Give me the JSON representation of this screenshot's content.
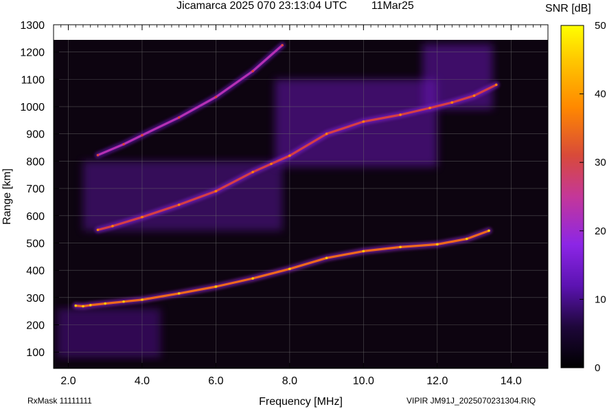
{
  "header": {
    "title": "Jicamarca 2025 070 23:13:04 UTC        11Mar25",
    "colorbar_label": "SNR [dB]"
  },
  "footer": {
    "rxmask": "RxMask 11111111",
    "filename": "VIPIR  JM91J_2025070231304.RIQ"
  },
  "chart_data": {
    "type": "heatmap",
    "title": "Jicamarca 2025 070 23:13:04 UTC        11Mar25",
    "xlabel": "Frequency [MHz]",
    "ylabel": "Range [km]",
    "xlim": [
      1.6,
      15.0
    ],
    "ylim": [
      40,
      1300
    ],
    "x_ticks": [
      2.0,
      4.0,
      6.0,
      8.0,
      10.0,
      12.0,
      14.0
    ],
    "x_tick_labels": [
      "2.0",
      "4.0",
      "6.0",
      "8.0",
      "10.0",
      "12.0",
      "14.0"
    ],
    "y_ticks": [
      100,
      200,
      300,
      400,
      500,
      600,
      700,
      800,
      900,
      1000,
      1100,
      1200,
      1300
    ],
    "y_tick_labels": [
      "100",
      "200",
      "300",
      "400",
      "500",
      "600",
      "700",
      "800",
      "900",
      "1000",
      "1100",
      "1200",
      "1300"
    ],
    "colorbar": {
      "label": "SNR [dB]",
      "range": [
        0,
        50
      ],
      "ticks": [
        0,
        10,
        20,
        30,
        40,
        50
      ],
      "tick_labels": [
        "0",
        "10",
        "20",
        "30",
        "40",
        "50"
      ],
      "colors": [
        "#000000",
        "#3a0a63",
        "#7a1fd6",
        "#b02ec4",
        "#d83f3f",
        "#ff8a00",
        "#ffff00"
      ]
    },
    "grid": true,
    "background_color": "#0d0410",
    "series": [
      {
        "trace": "first-hop",
        "snr_db": 38,
        "x": [
          2.2,
          2.4,
          2.6,
          3.0,
          3.5,
          4.0,
          5.0,
          6.0,
          7.0,
          8.0,
          9.0,
          10.0,
          11.0,
          12.0,
          12.8,
          13.4
        ],
        "y": [
          270,
          268,
          272,
          278,
          285,
          292,
          315,
          340,
          370,
          405,
          445,
          470,
          485,
          495,
          515,
          545
        ]
      },
      {
        "trace": "second-hop",
        "snr_db": 33,
        "x": [
          2.8,
          3.2,
          4.0,
          5.0,
          6.0,
          7.0,
          7.5,
          8.0,
          9.0,
          10.0,
          11.0,
          11.8,
          12.4,
          13.0,
          13.6
        ],
        "y": [
          548,
          562,
          595,
          640,
          690,
          760,
          790,
          820,
          900,
          945,
          970,
          995,
          1015,
          1040,
          1080
        ]
      },
      {
        "trace": "third-hop",
        "snr_db": 26,
        "x": [
          2.8,
          3.5,
          4.0,
          5.0,
          6.0,
          7.0,
          7.8
        ],
        "y": [
          822,
          862,
          895,
          960,
          1035,
          1130,
          1225
        ]
      }
    ],
    "spread_regions": [
      {
        "x": [
          2.4,
          7.8
        ],
        "y": [
          545,
          800
        ],
        "snr_db": 12
      },
      {
        "x": [
          7.6,
          12.0
        ],
        "y": [
          780,
          1100
        ],
        "snr_db": 14
      },
      {
        "x": [
          1.7,
          4.5
        ],
        "y": [
          80,
          260
        ],
        "snr_db": 11
      },
      {
        "x": [
          11.6,
          13.5
        ],
        "y": [
          990,
          1230
        ],
        "snr_db": 14
      }
    ]
  }
}
